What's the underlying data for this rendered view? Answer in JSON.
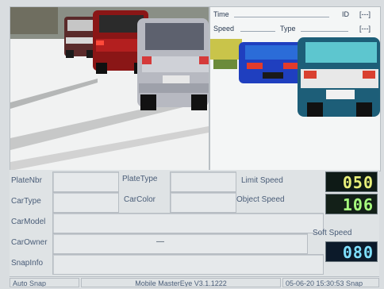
{
  "overlay": {
    "time_label": "Time",
    "speed_label": "Speed",
    "type_label": "Type",
    "id_label": "ID",
    "bracket_1": "[---]",
    "bracket_2": "[---]"
  },
  "fields": {
    "plate_nbr_label": "PlateNbr",
    "plate_type_label": "PlateType",
    "limit_speed_label": "Limit Speed",
    "car_type_label": "CarType",
    "car_color_label": "CarColor",
    "object_speed_label": "Object Speed",
    "car_model_label": "CarModel",
    "car_owner_label": "CarOwner",
    "car_owner_value": "—",
    "snap_info_label": "SnapInfo",
    "soft_speed_label": "Soft Speed"
  },
  "displays": {
    "limit_speed": "050",
    "object_speed": "106",
    "soft_speed": "080"
  },
  "status": {
    "mode": "Auto Snap",
    "version": "Mobile MasterEye V3.1.1222",
    "datetime": "05-06-20 15:30:53 Snap"
  },
  "colors": {
    "lcd_yellow": "#e8f07a",
    "lcd_green": "#a7ff7e",
    "lcd_blue": "#7fe0ff",
    "label_blue": "#4a5d78"
  },
  "icons": {
    "main_camera": "rear-view-of-cars-on-highway",
    "second_camera": "blue-and-white-cars-traffic"
  }
}
